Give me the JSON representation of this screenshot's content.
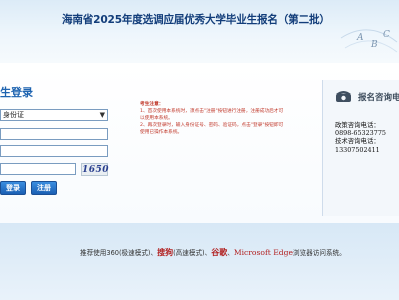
{
  "header": {
    "title": "海南省2025年度选调应届优秀大学毕业生报名（第二批）",
    "decor_letters": [
      "A",
      "B",
      "C"
    ]
  },
  "login": {
    "title": "生登录",
    "id_type_select": "身份证",
    "captcha_text": "1650",
    "login_button": "登录",
    "register_button": "注册"
  },
  "notice": {
    "heading": "考生注意：",
    "lines": [
      "1、首次使用本系统时，须点击\"注册\"按钮进行注册，注册成功后才可",
      "以使用本系统。",
      "2、再次登录时，输入身份证号、密码、验证码，点击\"登录\"按钮即可",
      "使用已操作本系统。"
    ]
  },
  "contact": {
    "title": "报名咨询电",
    "lines": [
      "政策咨询电话：",
      "0898-65323775",
      "技术咨询电话：",
      "13307502411"
    ]
  },
  "footer": {
    "prefix": "推荐使用360(",
    "part1": "极速模式)、",
    "sougou": "搜狗",
    "part2": "(高速模式)、",
    "google": "谷歌",
    "part3": "、",
    "edge": "Microsoft Edge",
    "suffix": "浏览器访问系统。"
  },
  "colors": {
    "title": "#123d7a",
    "accent_blue": "#1e63b0",
    "notice_red": "#c0392b",
    "footer_red": "#b22222"
  }
}
